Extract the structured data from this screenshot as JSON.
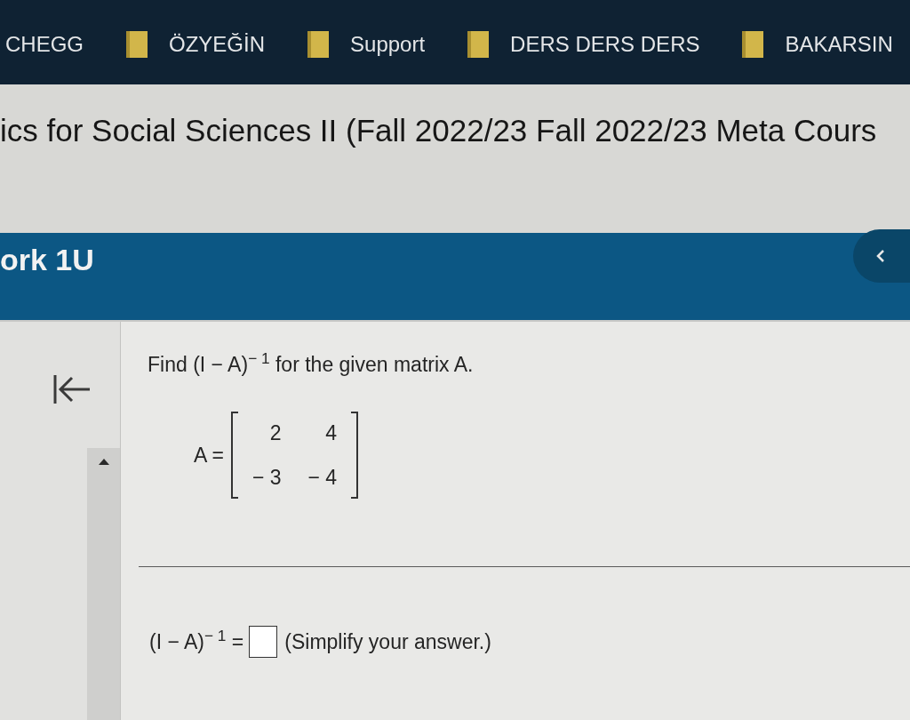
{
  "bookmarks_bar": {
    "items": [
      {
        "label": "CHEGG",
        "kind": "link"
      },
      {
        "label": "ÖZYEĞİN",
        "kind": "folder"
      },
      {
        "label": "Support",
        "kind": "folder"
      },
      {
        "label": "DERS DERS DERS",
        "kind": "folder"
      },
      {
        "label": "BAKARSIN",
        "kind": "folder"
      }
    ]
  },
  "course": {
    "title": "ics for Social Sciences II (Fall 2022/23 Fall 2022/23 Meta Cours"
  },
  "assignment_bar": {
    "title": "ork 1U"
  },
  "question": {
    "prompt": "Find (I − A)$^{− 1}$ for the given matrix A.",
    "matrix": {
      "label": "A =",
      "rows": [
        [
          "2",
          "4"
        ],
        [
          "− 3",
          "− 4"
        ]
      ]
    },
    "answer": {
      "label": "(I − A)$^{− 1}$ =",
      "instruction": "(Simplify your answer.)"
    }
  }
}
